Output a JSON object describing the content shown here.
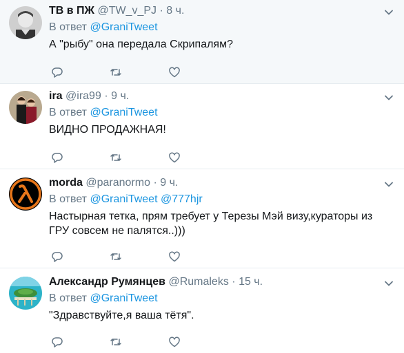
{
  "tweets": [
    {
      "name": "ТВ в ПЖ",
      "handle": "@TW_v_PJ",
      "sep": "·",
      "time": "8 ч.",
      "reply_prefix": "В ответ",
      "mentions": [
        "@GraniTweet"
      ],
      "text": "А \"рыбу\" она передала Скрипалям?"
    },
    {
      "name": "ira",
      "handle": "@ira99",
      "sep": "·",
      "time": "9 ч.",
      "reply_prefix": "В ответ",
      "mentions": [
        "@GraniTweet"
      ],
      "text": "ВИДНО ПРОДАЖНАЯ!"
    },
    {
      "name": "morda",
      "handle": "@paranormo",
      "sep": "·",
      "time": "9 ч.",
      "reply_prefix": "В ответ",
      "mentions": [
        "@GraniTweet",
        "@777hjr"
      ],
      "text": "Настырная тетка, прям требует у Терезы Мэй визу,кураторы из ГРУ совсем не палятся..)))"
    },
    {
      "name": "Александр Румянцев",
      "handle": "@Rumaleks",
      "sep": "·",
      "time": "15 ч.",
      "reply_prefix": "В ответ",
      "mentions": [
        "@GraniTweet"
      ],
      "text": "\"Здравствуйте,я ваша тётя\"."
    }
  ],
  "icons": {
    "reply": "reply-icon",
    "retweet": "retweet-icon",
    "like": "like-icon",
    "menu": "chevron-down-icon"
  },
  "colors": {
    "link": "#1b95e0",
    "muted": "#657786",
    "highlight_bg": "#f5f8fa"
  }
}
